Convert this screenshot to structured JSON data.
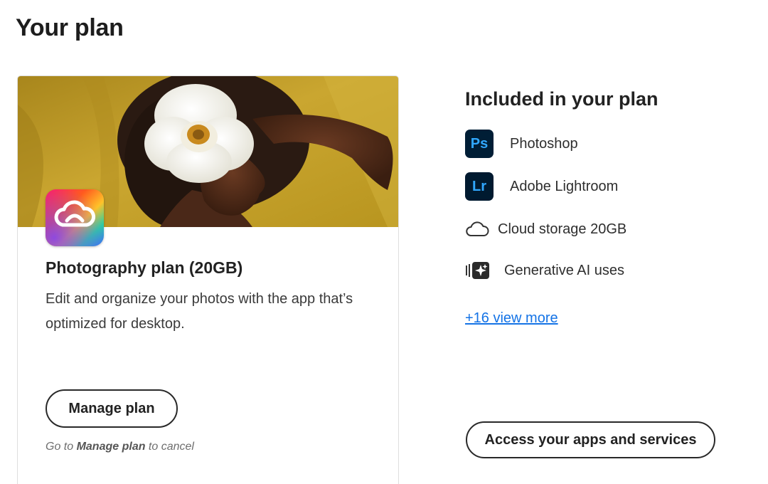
{
  "page": {
    "title": "Your plan"
  },
  "plan_card": {
    "name": "Photography plan (20GB)",
    "description": "Edit and organize your photos with the app that’s optimized for desktop.",
    "manage_button": "Manage plan",
    "cancel_note": {
      "prefix": "Go to ",
      "emphasis": "Manage plan",
      "suffix": " to cancel"
    },
    "logo_icon": "creative-cloud-icon"
  },
  "included": {
    "title": "Included in your plan",
    "items": [
      {
        "icon": "photoshop-icon",
        "icon_text": "Ps",
        "label": "Photoshop"
      },
      {
        "icon": "lightroom-icon",
        "icon_text": "Lr",
        "label": "Adobe Lightroom"
      },
      {
        "icon": "cloud-icon",
        "label": "Cloud storage 20GB"
      },
      {
        "icon": "generative-ai-icon",
        "label": "Generative AI uses"
      }
    ],
    "view_more": "+16 view more",
    "access_button": "Access your apps and services"
  },
  "colors": {
    "link": "#1473e6",
    "app_icon_bg": "#001e36",
    "app_icon_text": "#31a8ff",
    "hero_background": "#c8a52c"
  }
}
